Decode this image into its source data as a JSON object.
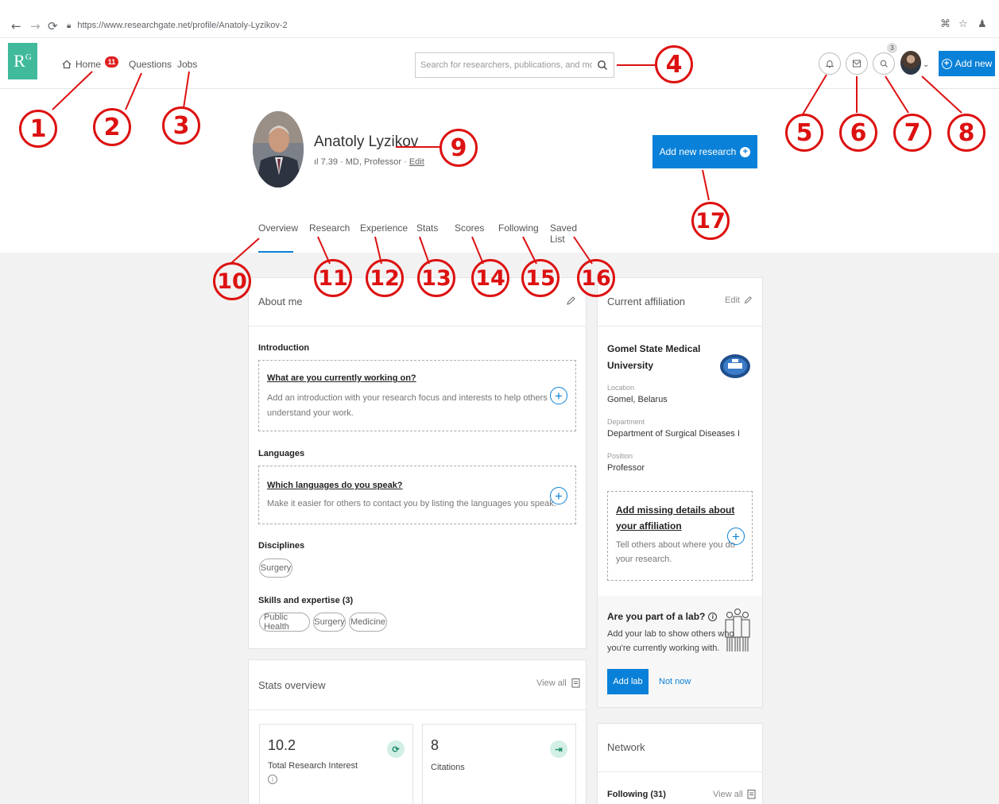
{
  "browser": {
    "url": "https://www.researchgate.net/profile/Anatoly-Lyzikov-2"
  },
  "header": {
    "logo": "R",
    "logo_sup": "G",
    "nav": [
      {
        "label": "Home",
        "badge": "11"
      },
      {
        "label": "Questions"
      },
      {
        "label": "Jobs"
      }
    ],
    "search_placeholder": "Search for researchers, publications, and more",
    "notif_badge": "3",
    "add_new_label": "Add new"
  },
  "profile": {
    "name": "Anatoly Lyzikov",
    "score": "7.39",
    "meta": "· MD, Professor ·",
    "edit_label": "Edit",
    "add_research_label": "Add new research"
  },
  "tabs": [
    "Overview",
    "Research",
    "Experience",
    "Stats",
    "Scores",
    "Following",
    "Saved List"
  ],
  "about": {
    "title": "About me",
    "intro_label": "Introduction",
    "intro_q": "What are you currently working on?",
    "intro_d1": "Add an introduction with your research focus and interests to help others",
    "intro_d2": "understand your work.",
    "lang_label": "Languages",
    "lang_q": "Which languages do you speak?",
    "lang_d": "Make it easier for others to contact you by listing the languages you speak.",
    "disc_label": "Disciplines",
    "disciplines": [
      "Surgery"
    ],
    "skills_label": "Skills and expertise (3)",
    "skills": [
      "Public Health",
      "Surgery",
      "Medicine"
    ]
  },
  "stats": {
    "title": "Stats overview",
    "view_all": "View all",
    "items": [
      {
        "value": "10.2",
        "label": "Total Research Interest"
      },
      {
        "value": "8",
        "label": "Citations"
      }
    ]
  },
  "affiliation": {
    "title": "Current affiliation",
    "edit_label": "Edit",
    "institution_l1": "Gomel State Medical",
    "institution_l2": "University",
    "location_label": "Location",
    "location": "Gomel, Belarus",
    "department_label": "Department",
    "department": "Department of Surgical Diseases I",
    "position_label": "Position",
    "position": "Professor",
    "missing_q1": "Add missing details about",
    "missing_q2": "your affiliation",
    "missing_d1": "Tell others about where you do",
    "missing_d2": "your research."
  },
  "lab": {
    "title": "Are you part of a lab?",
    "d1": "Add your lab to show others who",
    "d2": "you're currently working with.",
    "add_label": "Add lab",
    "not_now": "Not now"
  },
  "network": {
    "title": "Network",
    "following": "Following (31)",
    "view_all": "View all"
  },
  "annotations": [
    "1",
    "2",
    "3",
    "4",
    "5",
    "6",
    "7",
    "8",
    "9",
    "10",
    "11",
    "12",
    "13",
    "14",
    "15",
    "16",
    "17"
  ],
  "colors": {
    "brand": "#40ba9b",
    "primary": "#0a81d8",
    "annotation": "#dd1111"
  }
}
